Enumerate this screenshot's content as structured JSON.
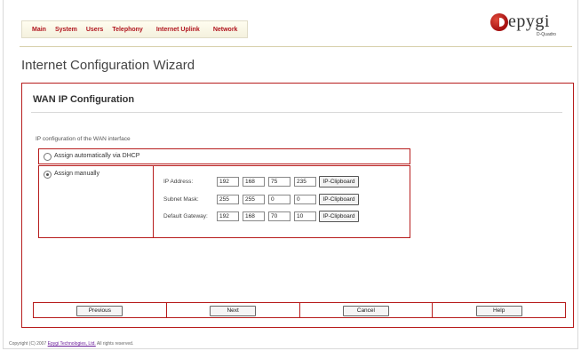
{
  "nav": {
    "items": [
      "Main",
      "System",
      "Users",
      "Telephony",
      "Internet Uplink",
      "Network"
    ]
  },
  "logo": {
    "word": "epygi",
    "sub": "D-Quadro"
  },
  "page_title": "Internet Configuration Wizard",
  "panel": {
    "title": "WAN IP Configuration",
    "caption": "IP configuration of the WAN interface",
    "option_dhcp": {
      "label": "Assign automatically via DHCP",
      "selected": false
    },
    "option_manual": {
      "label": "Assign manually",
      "selected": true
    },
    "fields": {
      "ip": {
        "label": "IP Address:",
        "octets": [
          "192",
          "168",
          "75",
          "235"
        ],
        "button": "IP-Clipboard"
      },
      "mask": {
        "label": "Subnet Mask:",
        "octets": [
          "255",
          "255",
          "0",
          "0"
        ],
        "button": "IP-Clipboard"
      },
      "gateway": {
        "label": "Default Gateway:",
        "octets": [
          "192",
          "168",
          "70",
          "10"
        ],
        "button": "IP-Clipboard"
      }
    }
  },
  "buttons": {
    "previous": "Previous",
    "next": "Next",
    "cancel": "Cancel",
    "help": "Help"
  },
  "footer": {
    "prefix": "Copyright (C) 2007 ",
    "link": "Epygi Technologies, Ltd.",
    "suffix": " All rights reserved."
  },
  "colors": {
    "accent": "#b71c1c",
    "nav_text": "#b0141d"
  }
}
